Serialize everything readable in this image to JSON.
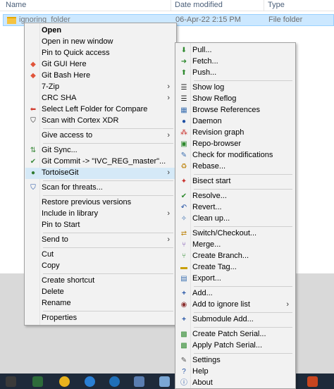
{
  "explorer": {
    "columns": {
      "name": "Name",
      "date": "Date modified",
      "type": "Type"
    },
    "row": {
      "name": "ignoring_folder",
      "date": "06-Apr-22 2:15 PM",
      "type": "File folder"
    }
  },
  "context_menu": {
    "items": [
      "Open",
      "Open in new window",
      "Pin to Quick access",
      "Git GUI Here",
      "Git Bash Here",
      "7-Zip",
      "CRC SHA",
      "Select Left Folder for Compare",
      "Scan with Cortex XDR",
      "Give access to",
      "Git Sync...",
      "Git Commit -> \"IVC_REG_master\"...",
      "TortoiseGit",
      "Scan for threats...",
      "Restore previous versions",
      "Include in library",
      "Pin to Start",
      "Send to",
      "Cut",
      "Copy",
      "Create shortcut",
      "Delete",
      "Rename",
      "Properties"
    ]
  },
  "tortoisegit_menu": {
    "items": [
      "Pull...",
      "Fetch...",
      "Push...",
      "Show log",
      "Show Reflog",
      "Browse References",
      "Daemon",
      "Revision graph",
      "Repo-browser",
      "Check for modifications",
      "Rebase...",
      "Bisect start",
      "Resolve...",
      "Revert...",
      "Clean up...",
      "Switch/Checkout...",
      "Merge...",
      "Create Branch...",
      "Create Tag...",
      "Export...",
      "Add...",
      "Add to ignore list",
      "Submodule Add...",
      "Create Patch Serial...",
      "Apply Patch Serial...",
      "Settings",
      "Help",
      "About"
    ]
  },
  "colors": {
    "selection": "#cce8ff",
    "menu_bg": "#f2f2f2",
    "highlight": "#d5e9f7"
  }
}
